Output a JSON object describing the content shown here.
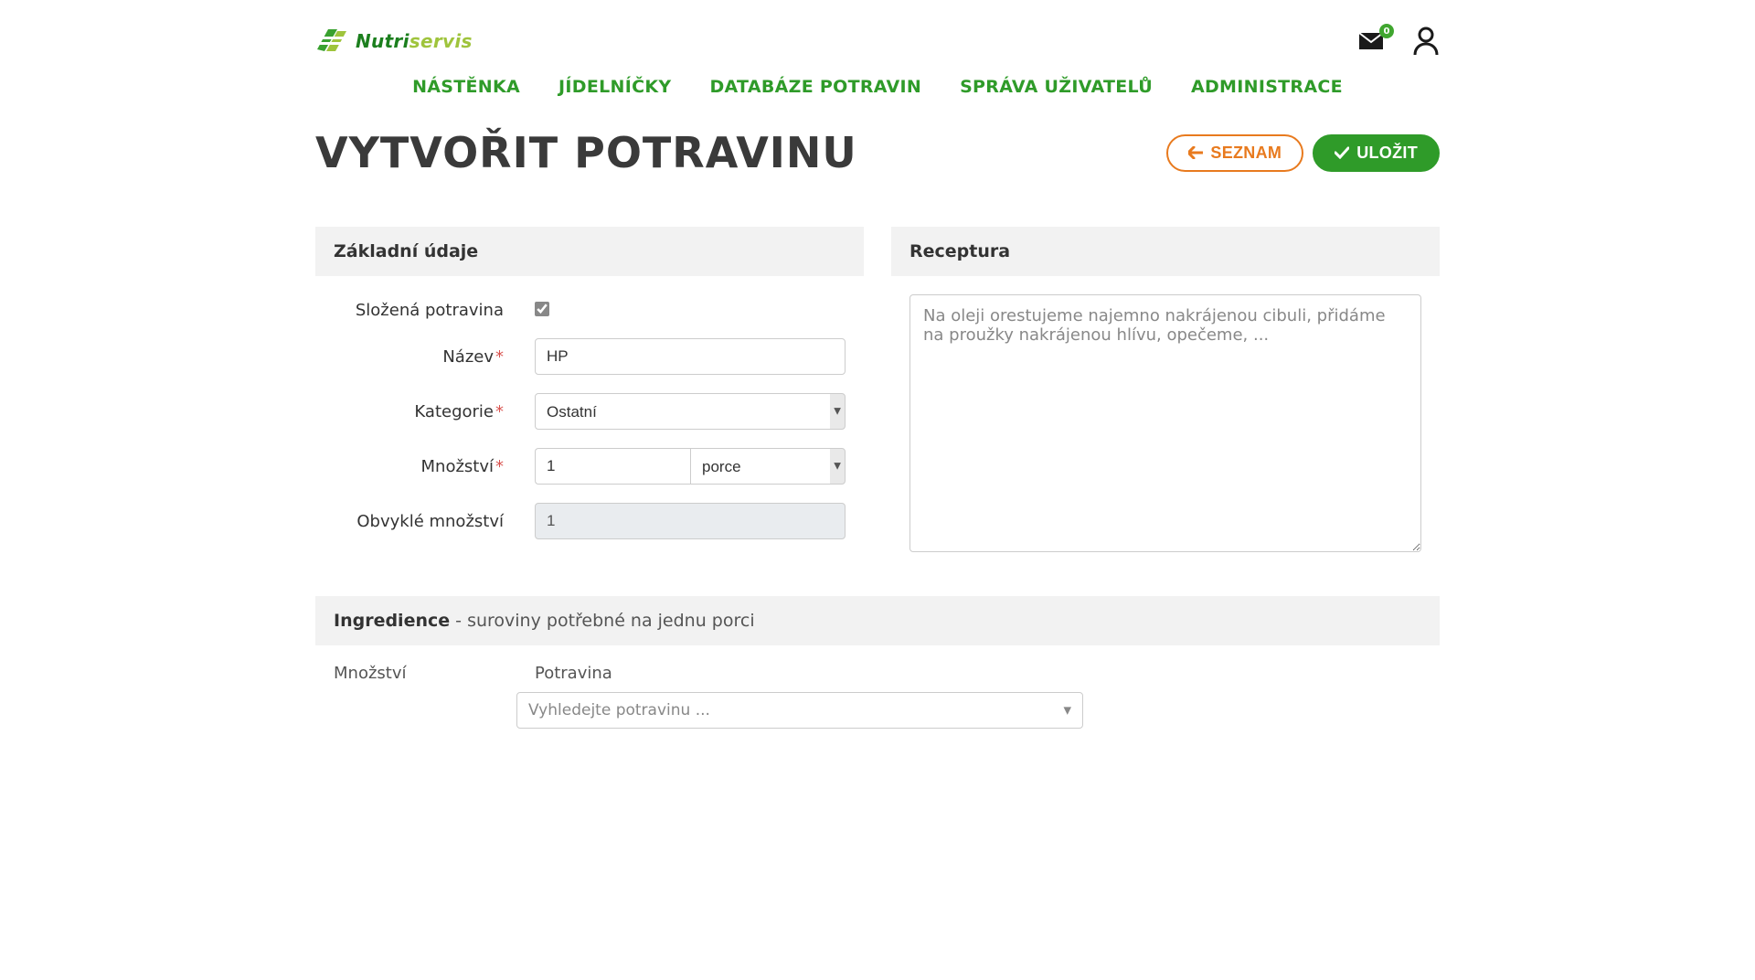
{
  "brand": {
    "name1": "Nutri",
    "name2": "servis"
  },
  "notifications": {
    "count": "0"
  },
  "nav": {
    "items": [
      "NÁSTĚNKA",
      "JÍDELNÍČKY",
      "DATABÁZE POTRAVIN",
      "SPRÁVA UŽIVATELŮ",
      "ADMINISTRACE"
    ]
  },
  "page": {
    "title": "VYTVOŘIT POTRAVINU",
    "list_btn": "SEZNAM",
    "save_btn": "ULOŽIT"
  },
  "basic": {
    "header": "Základní údaje",
    "labels": {
      "compound": "Složená potravina",
      "name": "Název",
      "category": "Kategorie",
      "amount": "Množství",
      "usual_amount": "Obvyklé množství"
    },
    "values": {
      "compound_checked": true,
      "name": "HP",
      "category": "Ostatní",
      "amount": "1",
      "unit": "porce",
      "usual_amount": "1"
    }
  },
  "recipe": {
    "header": "Receptura",
    "placeholder": "Na oleji orestujeme najemno nakrájenou cibuli, přidáme na proužky nakrájenou hlívu, opečeme, ..."
  },
  "ingredients": {
    "header_strong": "Ingredience",
    "header_rest": " - suroviny potřebné na jednu porci",
    "col_amount": "Množství",
    "col_food": "Potravina",
    "search_placeholder": "Vyhledejte potravinu ..."
  }
}
